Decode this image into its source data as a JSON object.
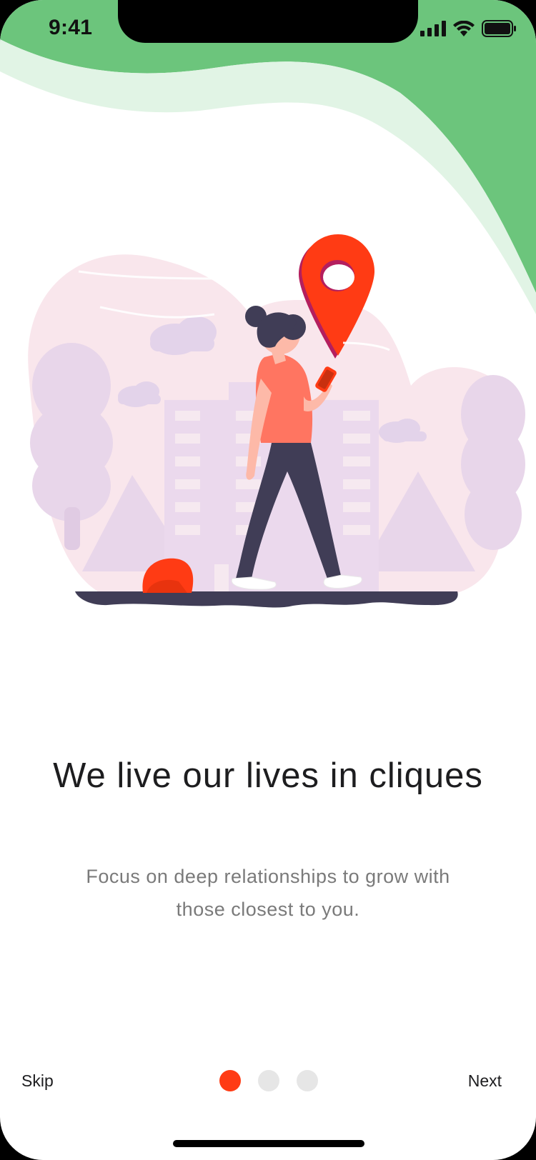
{
  "status_bar": {
    "time": "9:41"
  },
  "onboarding": {
    "title": "We live our lives in cliques",
    "subtitle": "Focus on deep relationships to grow with those closest to you.",
    "illustration_icon": "woman-walking-with-map-pin-illustration"
  },
  "controls": {
    "skip_label": "Skip",
    "next_label": "Next",
    "page_count": 3,
    "current_page": 1
  },
  "colors": {
    "accent": "#ff3b14",
    "wave_green": "#6cc57c",
    "wave_light_green": "#e1f4e5",
    "dot_inactive": "#e6e6e6",
    "title": "#1d1d1f",
    "subtitle": "#7a7a7a"
  }
}
